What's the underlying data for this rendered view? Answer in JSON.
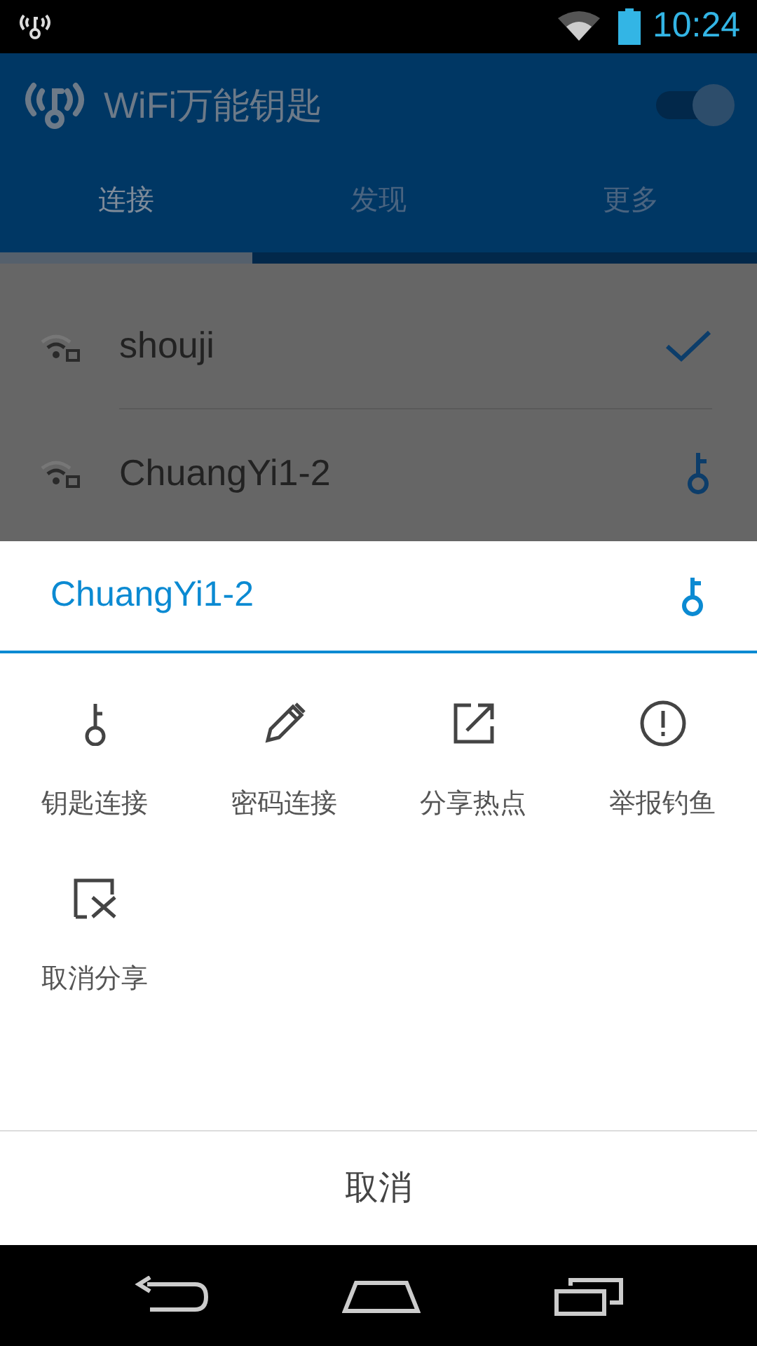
{
  "status_bar": {
    "time": "10:24"
  },
  "app_bar": {
    "title": "WiFi万能钥匙",
    "wifi_switch": {
      "on": true
    }
  },
  "tabs": [
    {
      "label": "连接",
      "selected": true
    },
    {
      "label": "发现",
      "selected": false
    },
    {
      "label": "更多",
      "selected": false
    }
  ],
  "networks": [
    {
      "name": "shouji",
      "kind": "connected"
    },
    {
      "name": "ChuangYi1-2",
      "kind": "key"
    }
  ],
  "sheet": {
    "title": "ChuangYi1-2",
    "actions": [
      {
        "label": "钥匙连接",
        "kind": "key"
      },
      {
        "label": "密码连接",
        "kind": "pencil"
      },
      {
        "label": "分享热点",
        "kind": "share"
      },
      {
        "label": "举报钓鱼",
        "kind": "alert"
      },
      {
        "label": "取消分享",
        "kind": "unshare"
      }
    ],
    "cancel": "取消"
  }
}
